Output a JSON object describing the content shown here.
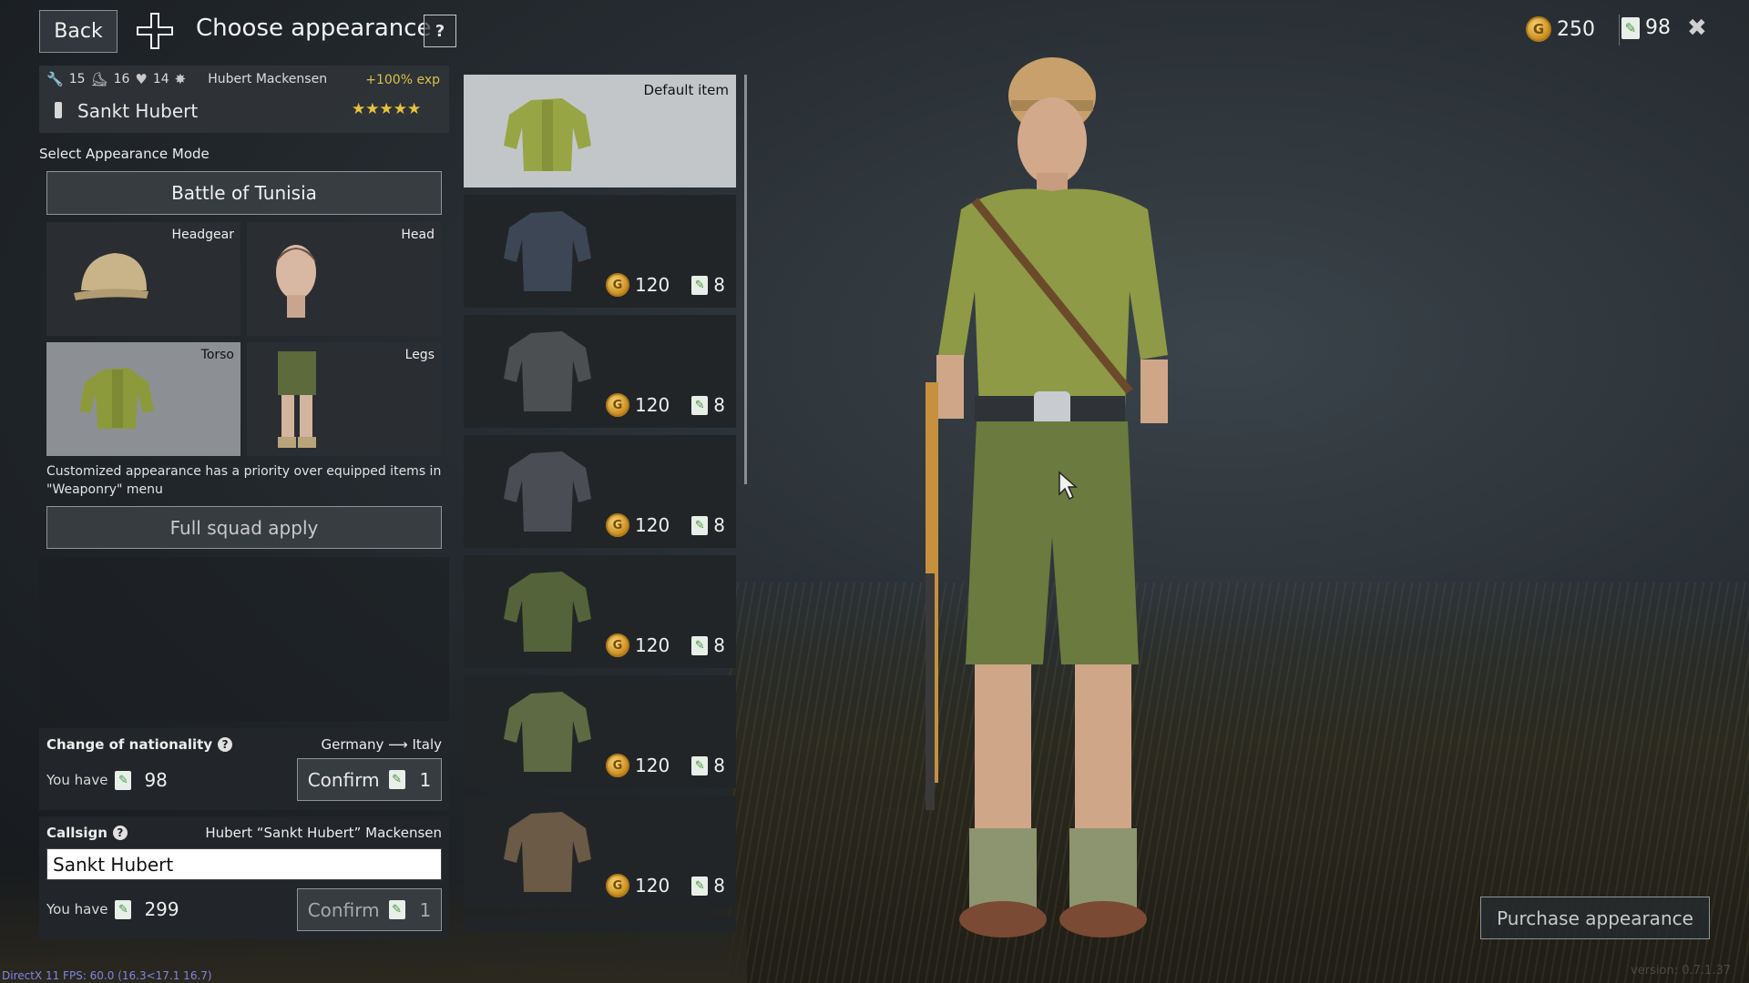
{
  "header": {
    "back_label": "Back",
    "title": "Choose appearance",
    "help_label": "?",
    "silver": "250",
    "tickets": "98"
  },
  "soldier": {
    "stat1": "15",
    "stat2": "16",
    "stat3": "14",
    "full_name": "Hubert Mackensen",
    "exp_bonus": "+100% exp",
    "callsign_name": "Sankt Hubert",
    "stars": "★★★★★"
  },
  "mode": {
    "label": "Select Appearance Mode",
    "value": "Battle of Tunisia"
  },
  "slots": [
    {
      "label": "Headgear"
    },
    {
      "label": "Head"
    },
    {
      "label": "Torso"
    },
    {
      "label": "Legs"
    }
  ],
  "priority_note": "Customized appearance has a priority over equipped items in \"Weaponry\" menu",
  "squad_apply_label": "Full squad apply",
  "nationality": {
    "title": "Change of nationality",
    "from_to": "Germany ⟶ Italy",
    "you_have_label": "You have",
    "you_have_amount": "98",
    "confirm_label": "Confirm",
    "confirm_cost": "1"
  },
  "callsign": {
    "title": "Callsign",
    "full": "Hubert “Sankt Hubert” Mackensen",
    "input_value": "Sankt Hubert",
    "you_have_label": "You have",
    "you_have_amount": "299",
    "confirm_label": "Confirm",
    "confirm_cost": "1"
  },
  "items": [
    {
      "label": "Default item"
    },
    {
      "price": "120",
      "tickets": "8",
      "color": "#3c4654"
    },
    {
      "price": "120",
      "tickets": "8",
      "color": "#4b4f52"
    },
    {
      "price": "120",
      "tickets": "8",
      "color": "#4a4e54"
    },
    {
      "price": "120",
      "tickets": "8",
      "color": "#55633a"
    },
    {
      "price": "120",
      "tickets": "8",
      "color": "#5e6a44"
    },
    {
      "price": "120",
      "tickets": "8",
      "color": "#6a5a46"
    }
  ],
  "purchase_label": "Purchase appearance",
  "version": "version: 0.7.1.37",
  "fps": "DirectX 11 FPS: 60.0 (16.3<17.1 16.7)",
  "icons": {
    "coin": "coin-icon",
    "ticket": "ticket-icon",
    "close": "close-icon",
    "cross": "iron-cross-icon"
  },
  "colors": {
    "accent_gold": "#e8c23e",
    "ticket_green": "#3f9b3a",
    "fps_blue": "#7f86e6"
  }
}
